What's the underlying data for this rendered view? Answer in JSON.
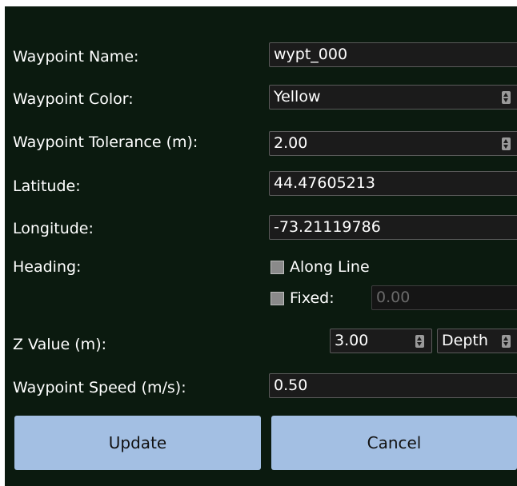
{
  "form": {
    "name_label": "Waypoint Name:",
    "name_value": "wypt_000",
    "color_label": "Waypoint Color:",
    "color_value": "Yellow",
    "tolerance_label": "Waypoint Tolerance (m):",
    "tolerance_value": "2.00",
    "latitude_label": "Latitude:",
    "latitude_value": "44.47605213",
    "longitude_label": "Longitude:",
    "longitude_value": "-73.21119786",
    "heading_label": "Heading:",
    "along_line_label": "Along Line",
    "fixed_label": "Fixed:",
    "fixed_value": "0.00",
    "z_label": "Z Value (m):",
    "z_value": "3.00",
    "z_mode_value": "Depth",
    "speed_label": "Waypoint Speed (m/s):",
    "speed_value": "0.50"
  },
  "buttons": {
    "update": "Update",
    "cancel": "Cancel"
  },
  "colors": {
    "background": "#0b1a0f",
    "button": "#a3bfe3"
  }
}
